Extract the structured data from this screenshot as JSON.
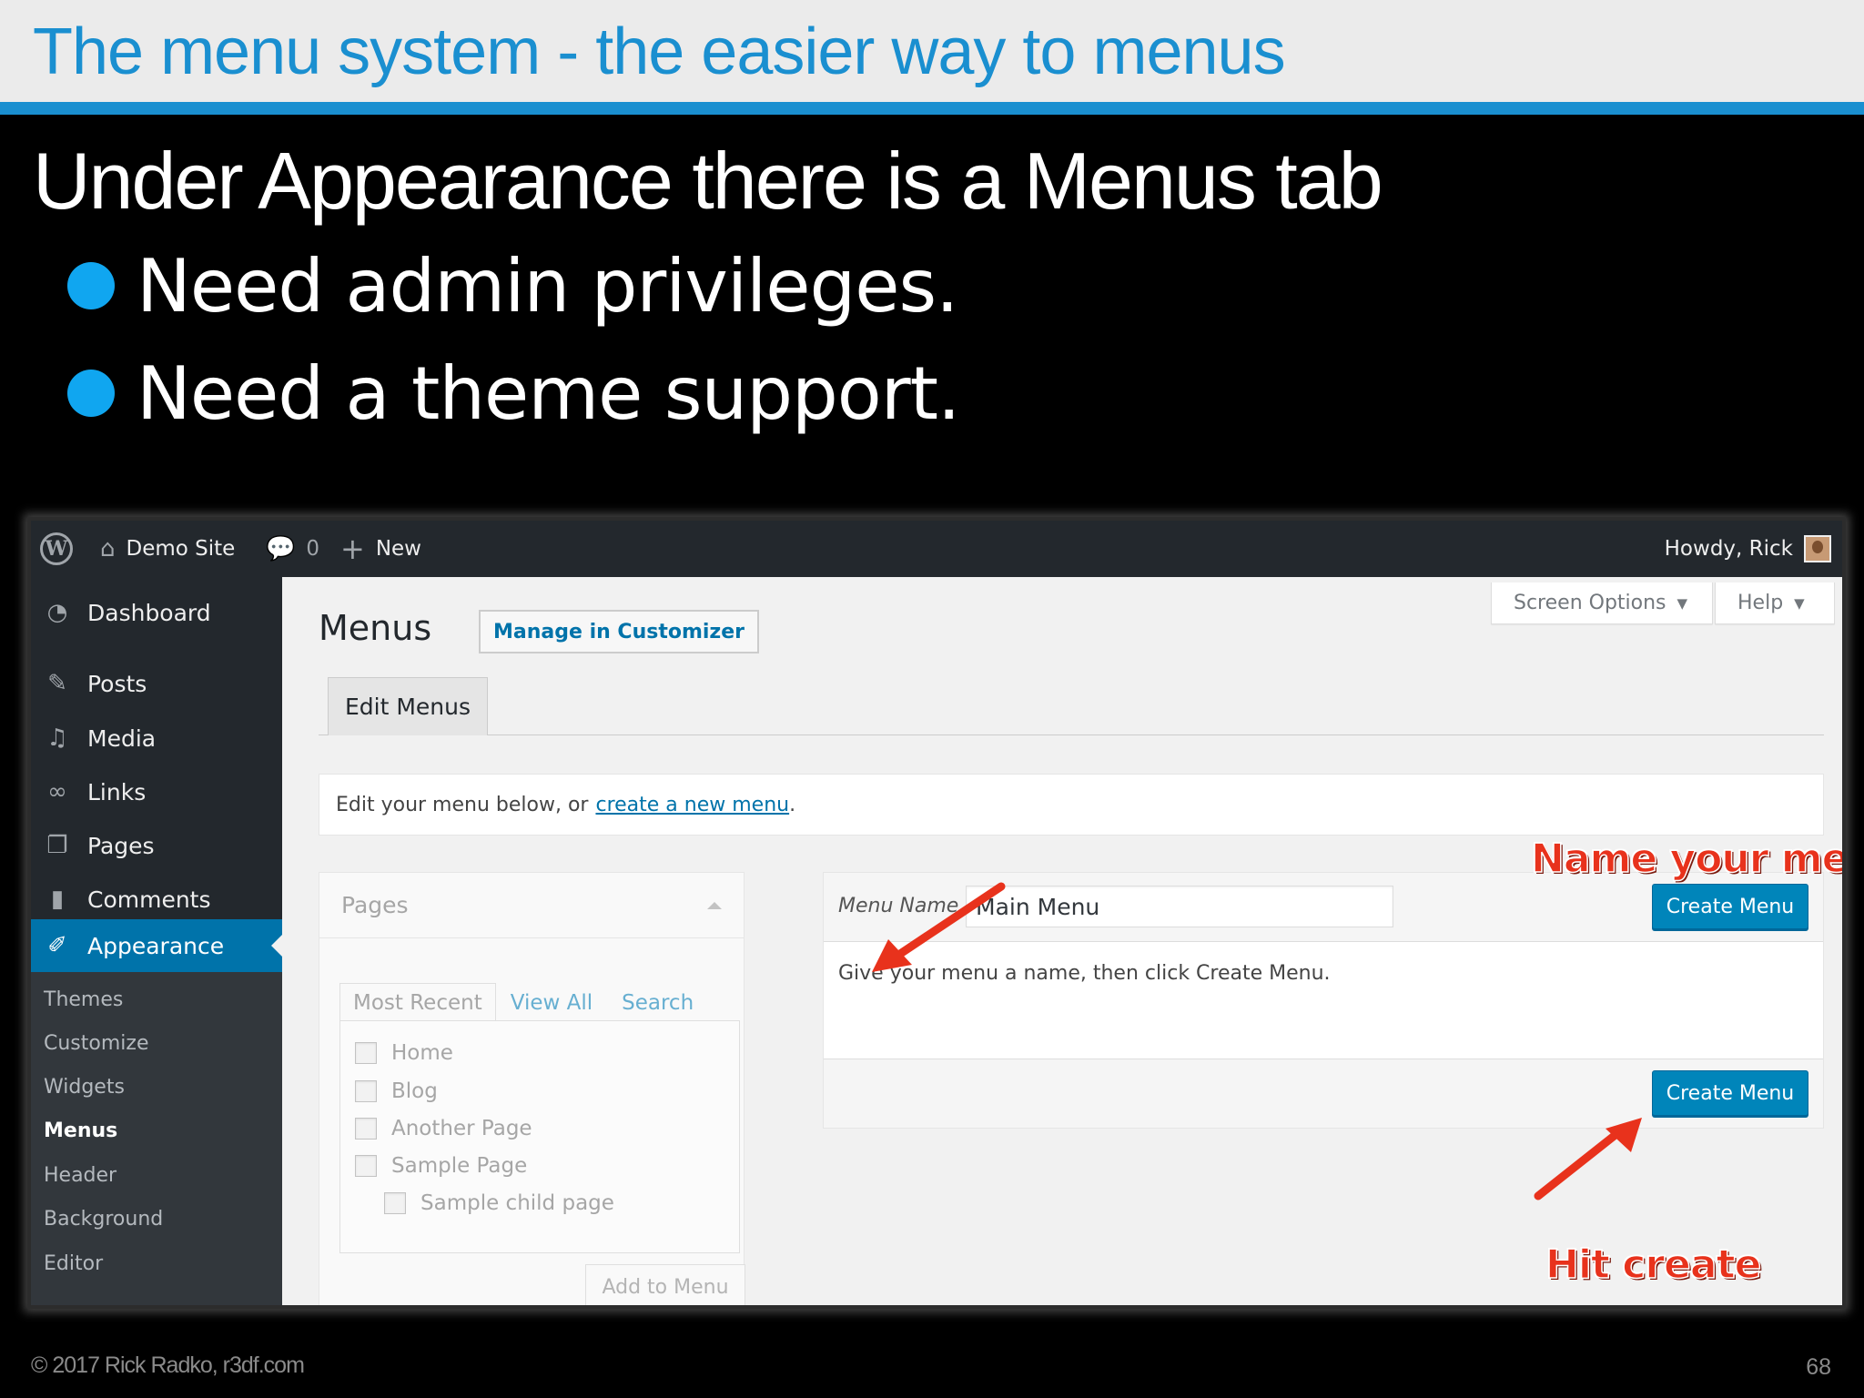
{
  "slide": {
    "title": "The menu system - the easier way to menus",
    "heading": "Under Appearance there is a Menus tab",
    "bullets": [
      "Need admin privileges.",
      "Need a theme support."
    ],
    "footer": "© 2017 Rick Radko, r3df.com",
    "page_number": "68",
    "colors": {
      "accent": "#1a8fd0",
      "bullet": "#10a6f0",
      "background": "#000000"
    }
  },
  "adminbar": {
    "logo_icon": "wordpress-icon",
    "site_name": "Demo Site",
    "comments_count": "0",
    "new_label": "New",
    "howdy": "Howdy, Rick"
  },
  "sidebar": {
    "items": [
      {
        "label": "Dashboard",
        "icon": "dashboard-icon"
      },
      {
        "label": "Posts",
        "icon": "pin-icon"
      },
      {
        "label": "Media",
        "icon": "media-icon"
      },
      {
        "label": "Links",
        "icon": "link-icon"
      },
      {
        "label": "Pages",
        "icon": "pages-icon"
      },
      {
        "label": "Comments",
        "icon": "comment-icon"
      },
      {
        "label": "Appearance",
        "icon": "brush-icon"
      }
    ],
    "submenu": [
      "Themes",
      "Customize",
      "Widgets",
      "Menus",
      "Header",
      "Background",
      "Editor"
    ]
  },
  "content": {
    "screen_options": "Screen Options",
    "help": "Help",
    "page_title": "Menus",
    "customizer_button": "Manage in Customizer",
    "tab_edit": "Edit Menus",
    "notice_text": "Edit your menu below, or",
    "notice_link": "create a new menu",
    "notice_end": "."
  },
  "pages_box": {
    "title": "Pages",
    "tabs": [
      "Most Recent",
      "View All",
      "Search"
    ],
    "items": [
      "Home",
      "Blog",
      "Another Page",
      "Sample Page",
      "Sample child page"
    ],
    "add_button": "Add to Menu"
  },
  "menu_mgmt": {
    "name_label": "Menu Name",
    "name_value": "Main Menu",
    "create_button": "Create Menu",
    "instructions": "Give your menu a name, then click Create Menu."
  },
  "annotations": {
    "name_your_menu": "Name your menu",
    "hit_create": "Hit create"
  }
}
